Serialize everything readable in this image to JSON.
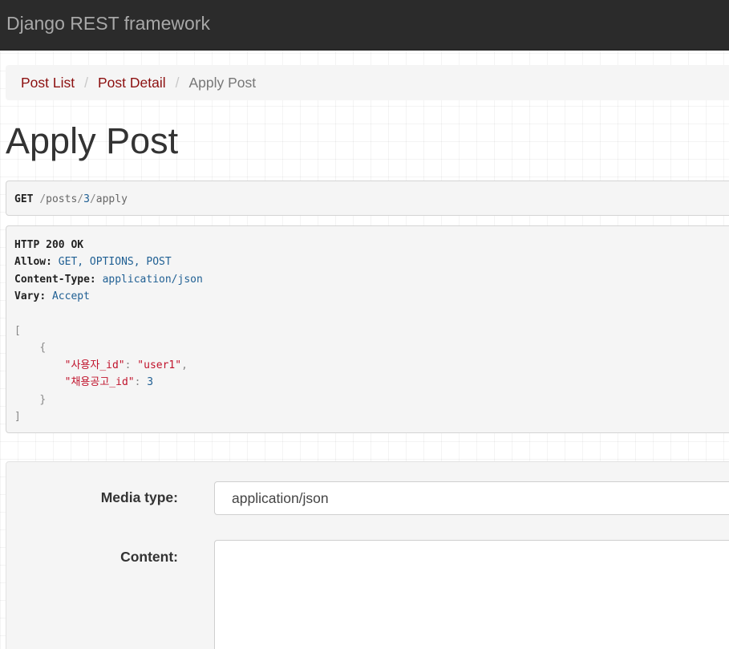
{
  "navbar": {
    "brand": "Django REST framework"
  },
  "breadcrumb": {
    "items": [
      "Post List",
      "Post Detail"
    ],
    "separator": "/",
    "active": "Apply Post"
  },
  "page": {
    "title": "Apply Post"
  },
  "request": {
    "method": "GET",
    "path_parts": [
      "/",
      "posts",
      "/",
      "3",
      "/",
      "apply"
    ]
  },
  "response": {
    "status": "HTTP 200 OK",
    "headers": [
      {
        "name": "Allow",
        "value": "GET, OPTIONS, POST"
      },
      {
        "name": "Content-Type",
        "value": "application/json"
      },
      {
        "name": "Vary",
        "value": "Accept"
      }
    ],
    "body": {
      "open_bracket": "[",
      "open_brace": "{",
      "fields": [
        {
          "key": "\"사용자_id\"",
          "value": "\"user1\"",
          "value_type": "string",
          "trailing": ","
        },
        {
          "key": "\"채용공고_id\"",
          "value": "3",
          "value_type": "number",
          "trailing": ""
        }
      ],
      "close_brace": "}",
      "close_bracket": "]"
    }
  },
  "form": {
    "media_type_label": "Media type:",
    "media_type_value": "application/json",
    "content_label": "Content:",
    "content_value": ""
  },
  "colors": {
    "navbar_bg": "#2b2b2b",
    "brand_text": "#a8a8a8",
    "link": "#8c1010",
    "json_string": "#c0122b",
    "json_literal": "#1f5f93"
  }
}
